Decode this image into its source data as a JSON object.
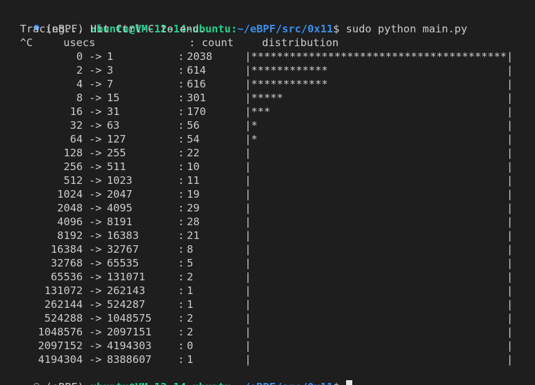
{
  "prompt": {
    "env": "(eBPF)",
    "userhost": "ubuntu@VM-12-14-ubuntu",
    "path_sep": ":",
    "path": "~/eBPF/src/0x11",
    "symbol": "$",
    "command": " sudo python main.py"
  },
  "output": {
    "tracing_message": "Tracing... Hit Ctrl-C to end.",
    "header": {
      "interrupt": "^C",
      "usecs_label": "usecs",
      "count_label": ": count",
      "distribution_label": "distribution"
    },
    "histogram": [
      {
        "lo": "0",
        "hi": "1",
        "count": "2038",
        "stars": "****************************************"
      },
      {
        "lo": "2",
        "hi": "3",
        "count": "614",
        "stars": "************"
      },
      {
        "lo": "4",
        "hi": "7",
        "count": "616",
        "stars": "************"
      },
      {
        "lo": "8",
        "hi": "15",
        "count": "301",
        "stars": "*****"
      },
      {
        "lo": "16",
        "hi": "31",
        "count": "170",
        "stars": "***"
      },
      {
        "lo": "32",
        "hi": "63",
        "count": "56",
        "stars": "*"
      },
      {
        "lo": "64",
        "hi": "127",
        "count": "54",
        "stars": "*"
      },
      {
        "lo": "128",
        "hi": "255",
        "count": "22",
        "stars": ""
      },
      {
        "lo": "256",
        "hi": "511",
        "count": "10",
        "stars": ""
      },
      {
        "lo": "512",
        "hi": "1023",
        "count": "11",
        "stars": ""
      },
      {
        "lo": "1024",
        "hi": "2047",
        "count": "19",
        "stars": ""
      },
      {
        "lo": "2048",
        "hi": "4095",
        "count": "29",
        "stars": ""
      },
      {
        "lo": "4096",
        "hi": "8191",
        "count": "28",
        "stars": ""
      },
      {
        "lo": "8192",
        "hi": "16383",
        "count": "21",
        "stars": ""
      },
      {
        "lo": "16384",
        "hi": "32767",
        "count": "8",
        "stars": ""
      },
      {
        "lo": "32768",
        "hi": "65535",
        "count": "5",
        "stars": ""
      },
      {
        "lo": "65536",
        "hi": "131071",
        "count": "2",
        "stars": ""
      },
      {
        "lo": "131072",
        "hi": "262143",
        "count": "1",
        "stars": ""
      },
      {
        "lo": "262144",
        "hi": "524287",
        "count": "1",
        "stars": ""
      },
      {
        "lo": "524288",
        "hi": "1048575",
        "count": "2",
        "stars": ""
      },
      {
        "lo": "1048576",
        "hi": "2097151",
        "count": "2",
        "stars": ""
      },
      {
        "lo": "2097152",
        "hi": "4194303",
        "count": "0",
        "stars": ""
      },
      {
        "lo": "4194304",
        "hi": "8388607",
        "count": "1",
        "stars": ""
      }
    ]
  },
  "colors": {
    "background": "#1e1e1e",
    "foreground": "#cccccc",
    "userhost": "#23d18b",
    "path": "#3b8eea",
    "prompt_dot_success": "#3b8eea"
  },
  "icons": {
    "first_prompt_marker": "command-success-dot-icon",
    "last_prompt_marker": "command-pending-circle-icon"
  }
}
